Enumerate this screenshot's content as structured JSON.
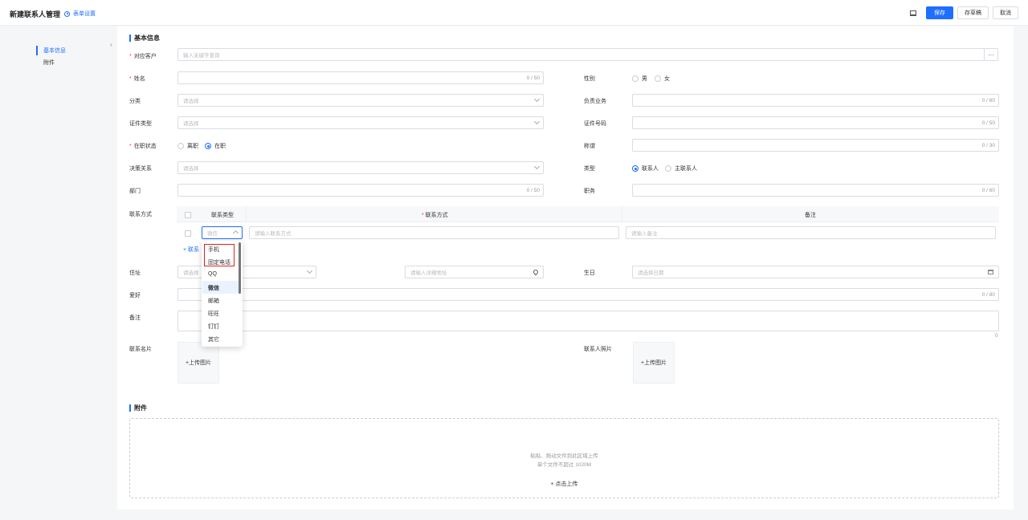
{
  "header": {
    "title": "新建联系人管理",
    "form_settings": "表单设置",
    "save": "保存",
    "draft": "存草稿",
    "cancel": "取消"
  },
  "sidenav": {
    "items": [
      "基本信息",
      "附件"
    ]
  },
  "sections": {
    "basic": "基本信息",
    "attachment": "附件"
  },
  "fields": {
    "customer": {
      "label": "对应客户",
      "placeholder": "输入关键字查询"
    },
    "name": {
      "label": "姓名",
      "count": "0 / 50"
    },
    "gender": {
      "label": "性别",
      "options": [
        "男",
        "女"
      ]
    },
    "category": {
      "label": "分类",
      "placeholder": "请选择"
    },
    "business": {
      "label": "负责业务",
      "count": "0 / 60"
    },
    "id_type": {
      "label": "证件类型",
      "placeholder": "请选择"
    },
    "id_number": {
      "label": "证件号码",
      "count": "0 / 50"
    },
    "status": {
      "label": "在职状态",
      "options": [
        "离职",
        "在职"
      ]
    },
    "honorific": {
      "label": "称谓",
      "count": "0 / 30"
    },
    "decision": {
      "label": "决策关系",
      "placeholder": "请选择"
    },
    "type": {
      "label": "类型",
      "options": [
        "联系人",
        "主联系人"
      ]
    },
    "dept": {
      "label": "部门",
      "count": "0 / 50"
    },
    "position": {
      "label": "职务",
      "count": "0 / 60"
    },
    "contact": {
      "label": "联系方式",
      "col_type": "联系类型",
      "col_method": "联系方式",
      "col_note": "备注",
      "type_value": "微信",
      "method_placeholder": "请输入联系方式",
      "note_placeholder": "请输入备注",
      "add_label": "联系"
    },
    "address": {
      "label": "住址",
      "select_placeholder": "请选择",
      "detail_placeholder": "请输入详细地址"
    },
    "birthday": {
      "label": "生日",
      "placeholder": "请选择日期"
    },
    "hobby": {
      "label": "爱好",
      "count": "0 / 80"
    },
    "note": {
      "label": "备注",
      "count": "0"
    },
    "card": {
      "label": "联系名片",
      "upload": "上传图片"
    },
    "photo": {
      "label": "联系人照片",
      "upload": "上传图片"
    }
  },
  "dropdown": {
    "options": [
      "手机",
      "固定电话",
      "QQ",
      "微信",
      "邮箱",
      "旺旺",
      "钉钉",
      "其它"
    ],
    "selected": "微信"
  },
  "dropzone": {
    "line1": "粘贴、拖动文件到此区域上传",
    "line2": "单个文件不超过 1020M",
    "button": "点击上传"
  }
}
